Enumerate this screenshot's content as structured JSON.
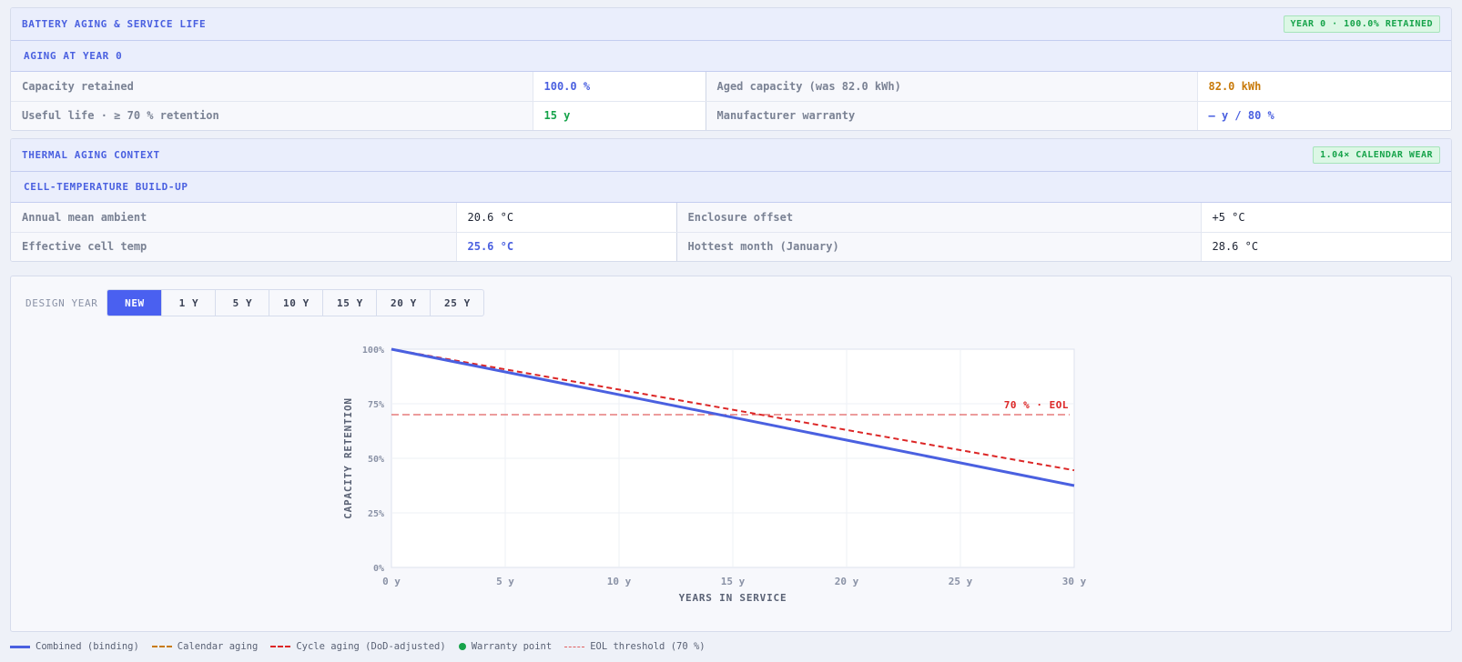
{
  "aging_panel": {
    "title": "BATTERY AGING & SERVICE LIFE",
    "badge": "YEAR 0 · 100.0% RETAINED",
    "subtitle": "AGING AT YEAR 0",
    "rows": [
      {
        "label1": "Capacity retained",
        "value1": "100.0 %",
        "label2": "Aged capacity (was 82.0 kWh)",
        "value2": "82.0 kWh"
      },
      {
        "label1": "Useful life · ≥ 70 % retention",
        "value1": "15 y",
        "label2": "Manufacturer warranty",
        "value2": "— y / 80 %"
      }
    ]
  },
  "thermal_panel": {
    "title": "THERMAL AGING CONTEXT",
    "badge": "1.04× CALENDAR WEAR",
    "subtitle": "CELL-TEMPERATURE BUILD-UP",
    "rows": [
      {
        "label1": "Annual mean ambient",
        "value1": "20.6 °C",
        "label2": "Enclosure offset",
        "value2": "+5 °C"
      },
      {
        "label1": "Effective cell temp",
        "value1": "25.6 °C",
        "label2": "Hottest month (January)",
        "value2": "28.6 °C"
      }
    ]
  },
  "design_year": {
    "label": "DESIGN YEAR",
    "options": [
      "NEW",
      "1 Y",
      "5 Y",
      "10 Y",
      "15 Y",
      "20 Y",
      "25 Y"
    ],
    "selected": "NEW"
  },
  "chart_data": {
    "type": "line",
    "xlabel": "YEARS IN SERVICE",
    "ylabel": "CAPACITY RETENTION",
    "xlim": [
      0,
      30
    ],
    "ylim": [
      0,
      100
    ],
    "x_ticks": [
      "0 y",
      "5 y",
      "10 y",
      "15 y",
      "20 y",
      "25 y",
      "30 y"
    ],
    "y_ticks": [
      "0%",
      "25%",
      "50%",
      "75%",
      "100%"
    ],
    "grid": true,
    "series": [
      {
        "name": "Combined (binding)",
        "x": [
          0,
          30
        ],
        "y": [
          100,
          37.5
        ],
        "color": "#4a60e0",
        "style": "solid"
      },
      {
        "name": "Cycle aging (DoD-adjusted)",
        "x": [
          0,
          30
        ],
        "y": [
          100,
          44.5
        ],
        "color": "#dc2626",
        "style": "dashed"
      }
    ],
    "threshold": {
      "name": "EOL threshold (70 %)",
      "value": 70,
      "label": "70 % · EOL",
      "color": "#e06060"
    }
  },
  "legend": {
    "items": [
      {
        "label": "Combined (binding)",
        "kind": "solid",
        "color": "#4a60e0"
      },
      {
        "label": "Calendar aging",
        "kind": "dashed",
        "color": "#c87a0a"
      },
      {
        "label": "Cycle aging (DoD-adjusted)",
        "kind": "dashed",
        "color": "#dc2626"
      },
      {
        "label": "Warranty point",
        "kind": "dot",
        "color": "#16a34a"
      },
      {
        "label": "EOL threshold (70 %)",
        "kind": "dotted",
        "color": "#e06060"
      }
    ]
  }
}
